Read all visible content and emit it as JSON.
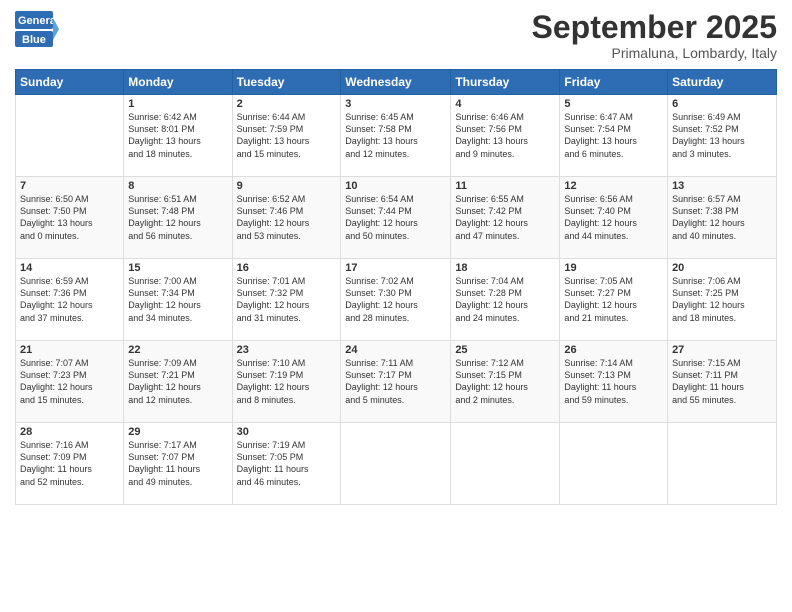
{
  "logo": {
    "general": "General",
    "blue": "Blue"
  },
  "title": "September 2025",
  "subtitle": "Primaluna, Lombardy, Italy",
  "headers": [
    "Sunday",
    "Monday",
    "Tuesday",
    "Wednesday",
    "Thursday",
    "Friday",
    "Saturday"
  ],
  "weeks": [
    [
      {
        "day": "",
        "lines": []
      },
      {
        "day": "1",
        "lines": [
          "Sunrise: 6:42 AM",
          "Sunset: 8:01 PM",
          "Daylight: 13 hours",
          "and 18 minutes."
        ]
      },
      {
        "day": "2",
        "lines": [
          "Sunrise: 6:44 AM",
          "Sunset: 7:59 PM",
          "Daylight: 13 hours",
          "and 15 minutes."
        ]
      },
      {
        "day": "3",
        "lines": [
          "Sunrise: 6:45 AM",
          "Sunset: 7:58 PM",
          "Daylight: 13 hours",
          "and 12 minutes."
        ]
      },
      {
        "day": "4",
        "lines": [
          "Sunrise: 6:46 AM",
          "Sunset: 7:56 PM",
          "Daylight: 13 hours",
          "and 9 minutes."
        ]
      },
      {
        "day": "5",
        "lines": [
          "Sunrise: 6:47 AM",
          "Sunset: 7:54 PM",
          "Daylight: 13 hours",
          "and 6 minutes."
        ]
      },
      {
        "day": "6",
        "lines": [
          "Sunrise: 6:49 AM",
          "Sunset: 7:52 PM",
          "Daylight: 13 hours",
          "and 3 minutes."
        ]
      }
    ],
    [
      {
        "day": "7",
        "lines": [
          "Sunrise: 6:50 AM",
          "Sunset: 7:50 PM",
          "Daylight: 13 hours",
          "and 0 minutes."
        ]
      },
      {
        "day": "8",
        "lines": [
          "Sunrise: 6:51 AM",
          "Sunset: 7:48 PM",
          "Daylight: 12 hours",
          "and 56 minutes."
        ]
      },
      {
        "day": "9",
        "lines": [
          "Sunrise: 6:52 AM",
          "Sunset: 7:46 PM",
          "Daylight: 12 hours",
          "and 53 minutes."
        ]
      },
      {
        "day": "10",
        "lines": [
          "Sunrise: 6:54 AM",
          "Sunset: 7:44 PM",
          "Daylight: 12 hours",
          "and 50 minutes."
        ]
      },
      {
        "day": "11",
        "lines": [
          "Sunrise: 6:55 AM",
          "Sunset: 7:42 PM",
          "Daylight: 12 hours",
          "and 47 minutes."
        ]
      },
      {
        "day": "12",
        "lines": [
          "Sunrise: 6:56 AM",
          "Sunset: 7:40 PM",
          "Daylight: 12 hours",
          "and 44 minutes."
        ]
      },
      {
        "day": "13",
        "lines": [
          "Sunrise: 6:57 AM",
          "Sunset: 7:38 PM",
          "Daylight: 12 hours",
          "and 40 minutes."
        ]
      }
    ],
    [
      {
        "day": "14",
        "lines": [
          "Sunrise: 6:59 AM",
          "Sunset: 7:36 PM",
          "Daylight: 12 hours",
          "and 37 minutes."
        ]
      },
      {
        "day": "15",
        "lines": [
          "Sunrise: 7:00 AM",
          "Sunset: 7:34 PM",
          "Daylight: 12 hours",
          "and 34 minutes."
        ]
      },
      {
        "day": "16",
        "lines": [
          "Sunrise: 7:01 AM",
          "Sunset: 7:32 PM",
          "Daylight: 12 hours",
          "and 31 minutes."
        ]
      },
      {
        "day": "17",
        "lines": [
          "Sunrise: 7:02 AM",
          "Sunset: 7:30 PM",
          "Daylight: 12 hours",
          "and 28 minutes."
        ]
      },
      {
        "day": "18",
        "lines": [
          "Sunrise: 7:04 AM",
          "Sunset: 7:28 PM",
          "Daylight: 12 hours",
          "and 24 minutes."
        ]
      },
      {
        "day": "19",
        "lines": [
          "Sunrise: 7:05 AM",
          "Sunset: 7:27 PM",
          "Daylight: 12 hours",
          "and 21 minutes."
        ]
      },
      {
        "day": "20",
        "lines": [
          "Sunrise: 7:06 AM",
          "Sunset: 7:25 PM",
          "Daylight: 12 hours",
          "and 18 minutes."
        ]
      }
    ],
    [
      {
        "day": "21",
        "lines": [
          "Sunrise: 7:07 AM",
          "Sunset: 7:23 PM",
          "Daylight: 12 hours",
          "and 15 minutes."
        ]
      },
      {
        "day": "22",
        "lines": [
          "Sunrise: 7:09 AM",
          "Sunset: 7:21 PM",
          "Daylight: 12 hours",
          "and 12 minutes."
        ]
      },
      {
        "day": "23",
        "lines": [
          "Sunrise: 7:10 AM",
          "Sunset: 7:19 PM",
          "Daylight: 12 hours",
          "and 8 minutes."
        ]
      },
      {
        "day": "24",
        "lines": [
          "Sunrise: 7:11 AM",
          "Sunset: 7:17 PM",
          "Daylight: 12 hours",
          "and 5 minutes."
        ]
      },
      {
        "day": "25",
        "lines": [
          "Sunrise: 7:12 AM",
          "Sunset: 7:15 PM",
          "Daylight: 12 hours",
          "and 2 minutes."
        ]
      },
      {
        "day": "26",
        "lines": [
          "Sunrise: 7:14 AM",
          "Sunset: 7:13 PM",
          "Daylight: 11 hours",
          "and 59 minutes."
        ]
      },
      {
        "day": "27",
        "lines": [
          "Sunrise: 7:15 AM",
          "Sunset: 7:11 PM",
          "Daylight: 11 hours",
          "and 55 minutes."
        ]
      }
    ],
    [
      {
        "day": "28",
        "lines": [
          "Sunrise: 7:16 AM",
          "Sunset: 7:09 PM",
          "Daylight: 11 hours",
          "and 52 minutes."
        ]
      },
      {
        "day": "29",
        "lines": [
          "Sunrise: 7:17 AM",
          "Sunset: 7:07 PM",
          "Daylight: 11 hours",
          "and 49 minutes."
        ]
      },
      {
        "day": "30",
        "lines": [
          "Sunrise: 7:19 AM",
          "Sunset: 7:05 PM",
          "Daylight: 11 hours",
          "and 46 minutes."
        ]
      },
      {
        "day": "",
        "lines": []
      },
      {
        "day": "",
        "lines": []
      },
      {
        "day": "",
        "lines": []
      },
      {
        "day": "",
        "lines": []
      }
    ]
  ]
}
